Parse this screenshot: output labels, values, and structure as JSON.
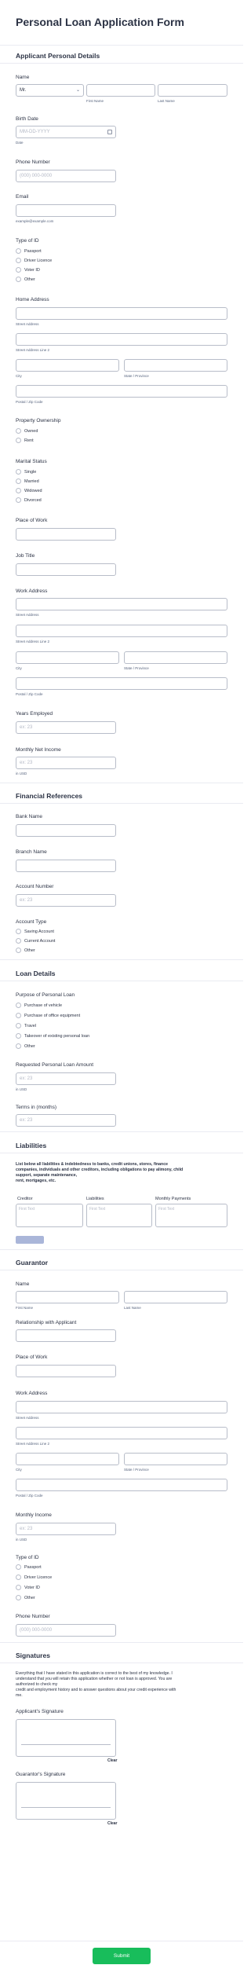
{
  "title": "Personal Loan Application Form",
  "sections": {
    "applicant": "Applicant Personal Details",
    "financial": "Financial References",
    "loan": "Loan Details",
    "liabilities": "Liabilities",
    "guarantor": "Guarantor",
    "signatures": "Signatures"
  },
  "applicant": {
    "name_label": "Name",
    "prefix_value": "Mr.",
    "first_name_sub": "First Name",
    "last_name_sub": "Last Name",
    "birth_label": "Birth Date",
    "birth_placeholder": "MM-DD-YYYY",
    "birth_sub": "Date",
    "phone_label": "Phone Number",
    "phone_placeholder": "(000) 000-0000",
    "email_label": "Email",
    "email_sub": "example@example.com",
    "id_type_label": "Type of ID",
    "id_types": [
      "Passport",
      "Driver Licence",
      "Voter ID",
      "Other"
    ],
    "home_address_label": "Home Address",
    "street_sub": "Street Address",
    "street2_sub": "Street Address Line 2",
    "city_sub": "City",
    "state_sub": "State / Province",
    "postal_sub": "Postal / Zip Code",
    "property_label": "Property Ownership",
    "property_options": [
      "Owned",
      "Rent"
    ],
    "marital_label": "Marital Status",
    "marital_options": [
      "Single",
      "Married",
      "Widowed",
      "Divorced"
    ],
    "place_of_work_label": "Place of Work",
    "job_title_label": "Job Title",
    "work_address_label": "Work Address",
    "work_street_sub": "Street Address",
    "work_street2_sub": "Street Address Line 2",
    "work_city_sub": "City",
    "work_state_sub": "State / Province",
    "work_postal_sub": "Postal / Zip Code",
    "years_employed_label": "Years Employed",
    "years_employed_placeholder": "ex: 23",
    "income_label": "Monthly Net Income",
    "income_placeholder": "ex: 23",
    "income_sub": "in USD"
  },
  "financial": {
    "bank_label": "Bank Name",
    "branch_label": "Branch Name",
    "account_label": "Account Number",
    "account_placeholder": "ex: 23",
    "account_type_label": "Account Type",
    "account_types": [
      "Saving Account",
      "Current Account",
      "Other"
    ]
  },
  "loan": {
    "purpose_label": "Purpose of Personal Loan",
    "purposes": [
      "Purchase of vehicle",
      "Purchase of office equipment",
      "Travel",
      "Takeover of existing personal loan",
      "Other"
    ],
    "amount_label": "Requested Personal Loan Amount",
    "amount_placeholder": "ex: 23",
    "amount_sub": "in USD",
    "terms_label": "Terms in (months)",
    "terms_placeholder": "ex: 23"
  },
  "liabilities": {
    "instruction_1": "List below all liabilities & indebtedness to banks, credit unions, stores, finance",
    "instruction_2": "companies, individuals and other creditors, including obligations to pay alimony, child",
    "instruction_3": "support, separate maintenance,",
    "instruction_4": "rent, mortgages, etc.",
    "col_creditor": "Creditor",
    "col_liabilities": "Liabilities",
    "col_payments": "Monthly Payments",
    "cell_placeholder": "First Text"
  },
  "guarantor": {
    "name_label": "Name",
    "first_name_sub": "First Name",
    "last_name_sub": "Last Name",
    "relationship_label": "Relationship with Applicant",
    "place_of_work_label": "Place of Work",
    "work_address_label": "Work Address",
    "street_sub": "Street Address",
    "street2_sub": "Street Address Line 2",
    "city_sub": "City",
    "state_sub": "State / Province",
    "postal_sub": "Postal / Zip Code",
    "income_label": "Monthly Income",
    "income_placeholder": "ex: 23",
    "income_sub": "in USD",
    "id_type_label": "Type of ID",
    "id_types": [
      "Passport",
      "Driver Licence",
      "Voter ID",
      "Other"
    ],
    "phone_label": "Phone Number",
    "phone_placeholder": "(000) 000-0000"
  },
  "signatures": {
    "declaration_1": "Everything that I have stated in this application is correct to the best of my knowledge. I",
    "declaration_2": "understand that you will retain this application whether or not loan is approved. You are",
    "declaration_3": "authorized to check my",
    "declaration_4": "credit and employment history and to answer questions about your credit experience with",
    "declaration_5": "me.",
    "applicant_label": "Applicant's Signature",
    "guarantor_label": "Guarantor's Signature",
    "clear_label": "Clear"
  },
  "submit_label": "Submit",
  "colors": {
    "submit": "#18bd5b",
    "text": "#2c3345",
    "border": "#b8bdc9",
    "add_row": "#aab6d9"
  }
}
